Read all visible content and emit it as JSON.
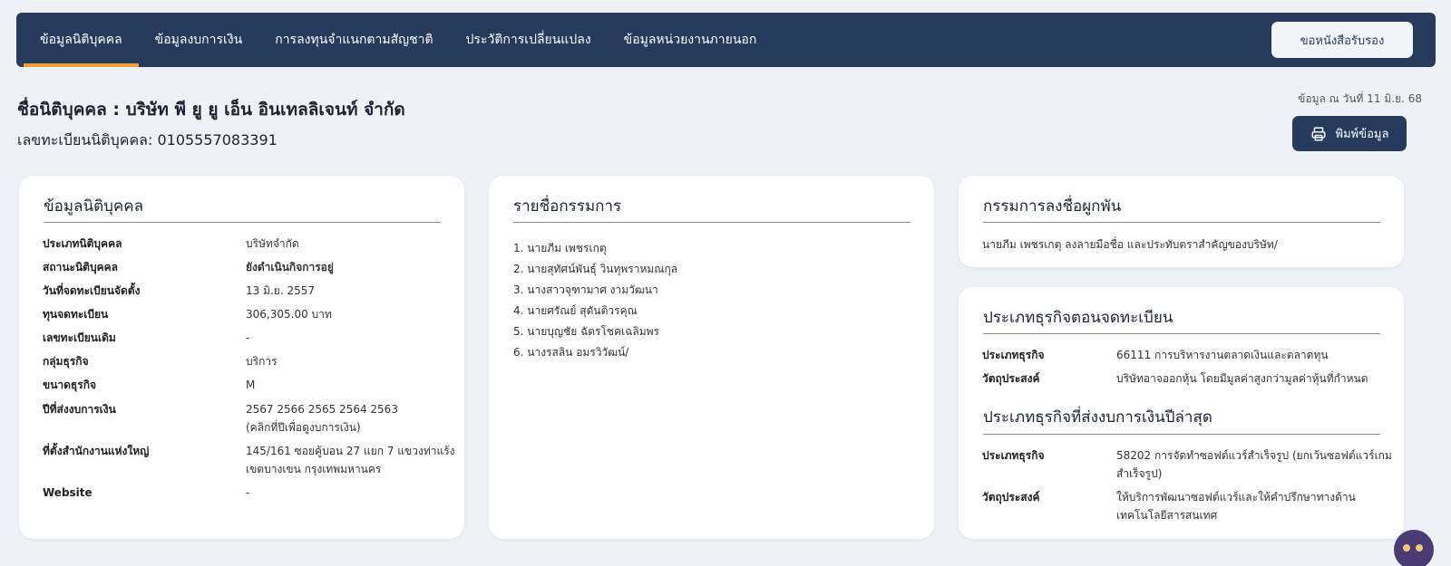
{
  "nav": {
    "tabs": [
      {
        "label": "ข้อมูลนิติบุคคล",
        "active": true
      },
      {
        "label": "ข้อมูลงบการเงิน",
        "active": false
      },
      {
        "label": "การลงทุนจำแนกตามสัญชาติ",
        "active": false
      },
      {
        "label": "ประวัติการเปลี่ยนแปลง",
        "active": false
      },
      {
        "label": "ข้อมูลหน่วยงานภายนอก",
        "active": false
      }
    ],
    "cert_button": "ขอหนังสือรับรอง"
  },
  "header": {
    "company_name": "ชื่อนิติบุคคล : บริษัท พี ยู ยู เอ็น อินเทลลิเจนท์ จำกัด",
    "reg_number": "เลขทะเบียนนิติบุคคล: 0105557083391",
    "data_date": "ข้อมูล ณ วันที่ 11 มิ.ย. 68",
    "print_button": "พิมพ์ข้อมูล",
    "print_icon": "printer-icon"
  },
  "entity": {
    "title": "ข้อมูลนิติบุคคล",
    "rows": [
      {
        "label": "ประเภทนิติบุคคล",
        "value": "บริษัทจำกัด"
      },
      {
        "label": "สถานะนิติบุคคล",
        "value": "ยังดำเนินกิจการอยู่"
      },
      {
        "label": "วันที่จดทะเบียนจัดตั้ง",
        "value": "13 มิ.ย. 2557"
      },
      {
        "label": "ทุนจดทะเบียน",
        "value": "306,305.00 บาท"
      },
      {
        "label": "เลขทะเบียนเดิม",
        "value": "-"
      },
      {
        "label": "กลุ่มธุรกิจ",
        "value": "บริการ"
      },
      {
        "label": "ขนาดธุรกิจ",
        "value": "M"
      },
      {
        "label": "ปีที่ส่งงบการเงิน",
        "value": "2567 2566 2565 2564 2563",
        "value2": "(คลิกที่ปีเพื่อดูงบการเงิน)"
      },
      {
        "label": "ที่ตั้งสำนักงานแห่งใหญ่",
        "value": "145/161 ซอยคู้บอน 27 แยก 7 แขวงท่าแร้ง",
        "value2": "เขตบางเขน กรุงเทพมหานคร"
      },
      {
        "label": "Website",
        "value": "-"
      }
    ],
    "status_color": "#2e8a2e"
  },
  "directors": {
    "title": "รายชื่อกรรมการ",
    "items": [
      "1. นายภีม เพชรเกตุ",
      "2. นายสุทัศน์พันธุ์ วินทุพราหมณกุล",
      "3. นางสาวจุฑามาศ งามวัฒนา",
      "4. นายศรัณย์ สุดันติวรคุณ",
      "5. นายบุญชัย ฉัตรโชคเฉลิมพร",
      "6. นางรสลิน อมรวิวัฒน์/"
    ]
  },
  "signing": {
    "title": "กรรมการลงชื่อผูกพัน",
    "text": "นายภีม เพชรเกตุ ลงลายมือชื่อ และประทับตราสำคัญของบริษัท/"
  },
  "business_reg": {
    "title": "ประเภทธุรกิจตอนจดทะเบียน",
    "rows": [
      {
        "label": "ประเภทธุรกิจ",
        "value": "66111 การบริหารงานตลาดเงินและตลาดทุน"
      },
      {
        "label": "วัตถุประสงค์",
        "value": "บริษัทอาจออกหุ้น โดยมีมูลค่าสูงกว่ามูลค่าหุ้นที่กำหนด"
      }
    ]
  },
  "business_latest": {
    "title": "ประเภทธุรกิจที่ส่งงบการเงินปีล่าสุด",
    "rows": [
      {
        "label": "ประเภทธุรกิจ",
        "value": "58202 การจัดทำซอฟต์แวร์สำเร็จรูป (ยกเว้นซอฟต์แวร์เกม",
        "value2": "สำเร็จรูป)"
      },
      {
        "label": "วัตถุประสงค์",
        "value": "ให้บริการพัฒนาซอฟต์แวร์และให้คำปรึกษาทางด้าน",
        "value2": "เทคโนโลยีสารสนเทศ"
      }
    ]
  },
  "colors": {
    "navbar": "#263a5b",
    "active_tab_indicator": "#f0a030",
    "background": "#eef1f5"
  }
}
